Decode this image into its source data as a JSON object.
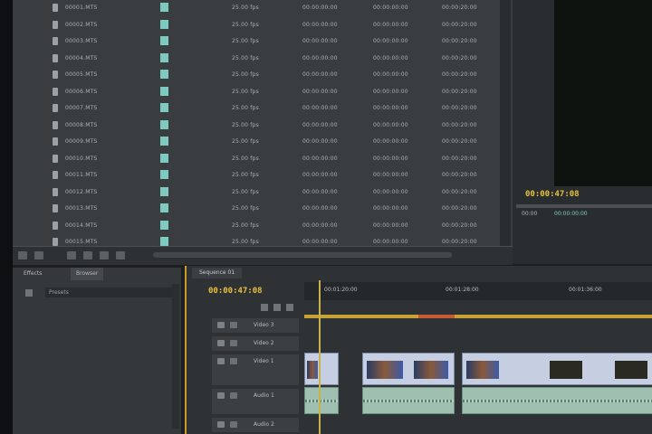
{
  "project_rows": [
    {
      "name": "00001.MTS",
      "size": "00:00:00:00",
      "rate": "25.00 fps",
      "start": "00:00:00:00",
      "dur": "00:00:20:00"
    },
    {
      "name": "00002.MTS",
      "size": "00:00:00:00",
      "rate": "25.00 fps",
      "start": "00:00:00:00",
      "dur": "00:00:20:00"
    },
    {
      "name": "00003.MTS",
      "size": "00:00:00:00",
      "rate": "25.00 fps",
      "start": "00:00:00:00",
      "dur": "00:00:20:00"
    },
    {
      "name": "00004.MTS",
      "size": "00:00:00:00",
      "rate": "25.00 fps",
      "start": "00:00:00:00",
      "dur": "00:00:20:00"
    },
    {
      "name": "00005.MTS",
      "size": "00:00:00:00",
      "rate": "25.00 fps",
      "start": "00:00:00:00",
      "dur": "00:00:20:00"
    },
    {
      "name": "00006.MTS",
      "size": "00:00:00:00",
      "rate": "25.00 fps",
      "start": "00:00:00:00",
      "dur": "00:00:20:00"
    },
    {
      "name": "00007.MTS",
      "size": "00:00:00:00",
      "rate": "25.00 fps",
      "start": "00:00:00:00",
      "dur": "00:00:20:00"
    },
    {
      "name": "00008.MTS",
      "size": "00:00:00:00",
      "rate": "25.00 fps",
      "start": "00:00:00:00",
      "dur": "00:00:20:00"
    },
    {
      "name": "00009.MTS",
      "size": "00:00:00:00",
      "rate": "25.00 fps",
      "start": "00:00:00:00",
      "dur": "00:00:20:00"
    },
    {
      "name": "00010.MTS",
      "size": "00:00:00:00",
      "rate": "25.00 fps",
      "start": "00:00:00:00",
      "dur": "00:00:20:00"
    },
    {
      "name": "00011.MTS",
      "size": "00:00:00:00",
      "rate": "25.00 fps",
      "start": "00:00:00:00",
      "dur": "00:00:20:00"
    },
    {
      "name": "00012.MTS",
      "size": "00:00:00:00",
      "rate": "25.00 fps",
      "start": "00:00:00:00",
      "dur": "00:00:20:00"
    },
    {
      "name": "00013.MTS",
      "size": "00:00:00:00",
      "rate": "25.00 fps",
      "start": "00:00:00:00",
      "dur": "00:00:20:00"
    },
    {
      "name": "00014.MTS",
      "size": "00:00:00:00",
      "rate": "25.00 fps",
      "start": "00:00:00:00",
      "dur": "00:00:20:00"
    },
    {
      "name": "00015.MTS",
      "size": "00:00:00:00",
      "rate": "25.00 fps",
      "start": "00:00:00:00",
      "dur": "00:00:20:00"
    }
  ],
  "program": {
    "timecode": "00:00:47:08",
    "field_a": "00:00",
    "field_b": "00:00:00:00"
  },
  "tools": {
    "tab1": "Effects",
    "tab2": "Browser",
    "field": "Presets"
  },
  "timeline": {
    "seq_tab": "Sequence 01",
    "timecode": "00:00:47:08",
    "ruler": [
      "00:01:20:00",
      "00:01:28:00",
      "00:01:36:00"
    ],
    "tracks": [
      "Video 3",
      "Video 2",
      "Video 1",
      "Audio 1",
      "Audio 2"
    ]
  },
  "colors": {
    "accent": "#e8c23a",
    "label": "#7ec9c0"
  }
}
